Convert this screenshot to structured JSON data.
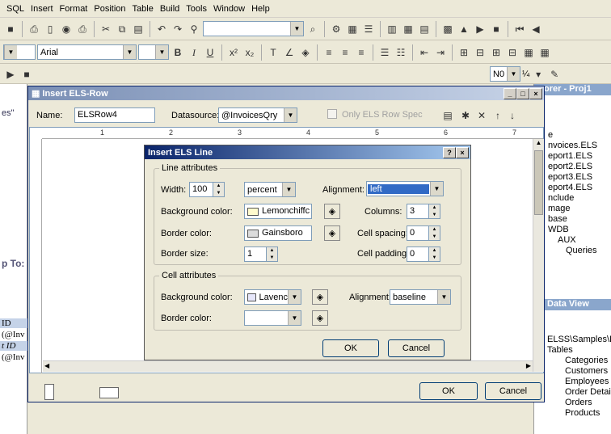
{
  "menu": [
    "SQL",
    "Insert",
    "Format",
    "Position",
    "Table",
    "Build",
    "Tools",
    "Window",
    "Help"
  ],
  "font": {
    "name": "Arial"
  },
  "toolbar_zoom": "N0",
  "toolbar_frac": "¼",
  "left_panel": {
    "frag1": "es\"",
    "frag2": "p To:",
    "frag3": "ID",
    "frag4": "(@Inv",
    "frag5": "t ID",
    "frag6": "(@Inv"
  },
  "right_panel": {
    "title": "orer - Proj1",
    "files": [
      "e",
      "nvoices.ELS",
      "eport1.ELS",
      "eport2.ELS",
      "eport3.ELS",
      "eport4.ELS",
      "nclude",
      "mage",
      "base",
      "WDB",
      "AUX",
      "Queries"
    ],
    "data_view_title": "Data View",
    "path": "ELSS\\Samples\\D.",
    "tables_label": "Tables",
    "tables": [
      "Categories",
      "Customers",
      "Employees",
      "Order Details",
      "Orders",
      "Products"
    ]
  },
  "els_row": {
    "title": "Insert ELS-Row",
    "name_label": "Name:",
    "name_value": "ELSRow4",
    "datasource_label": "Datasource:",
    "datasource_value": "@InvoicesQry",
    "only_spec": "Only ELS Row Spec",
    "ok": "OK",
    "cancel": "Cancel",
    "ruler": [
      "1",
      "2",
      "3",
      "4",
      "5",
      "6",
      "7"
    ]
  },
  "els_line": {
    "title": "Insert ELS Line",
    "help": "?",
    "close": "×",
    "line_group": "Line attributes",
    "width_label": "Width:",
    "width_value": "100",
    "width_unit": "percent",
    "alignment_label": "Alignment:",
    "alignment_value": "left",
    "bg_label": "Background color:",
    "bg_value": "Lemonchiffc",
    "bg_color": "#fffacd",
    "columns_label": "Columns:",
    "columns_value": "3",
    "border_label": "Border color:",
    "border_value": "Gainsboro",
    "border_color": "#dcdcdc",
    "cellspacing_label": "Cell spacing:",
    "cellspacing_value": "0",
    "bordersize_label": "Border size:",
    "bordersize_value": "1",
    "cellpadding_label": "Cell padding:",
    "cellpadding_value": "0",
    "cell_group": "Cell attributes",
    "cell_bg_label": "Background color:",
    "cell_bg_value": "Lavenc",
    "cell_bg_color": "#e6e6fa",
    "cell_align_label": "Alignment:",
    "cell_align_value": "baseline",
    "cell_border_label": "Border color:",
    "cell_border_value": "",
    "ok": "OK",
    "cancel": "Cancel"
  }
}
